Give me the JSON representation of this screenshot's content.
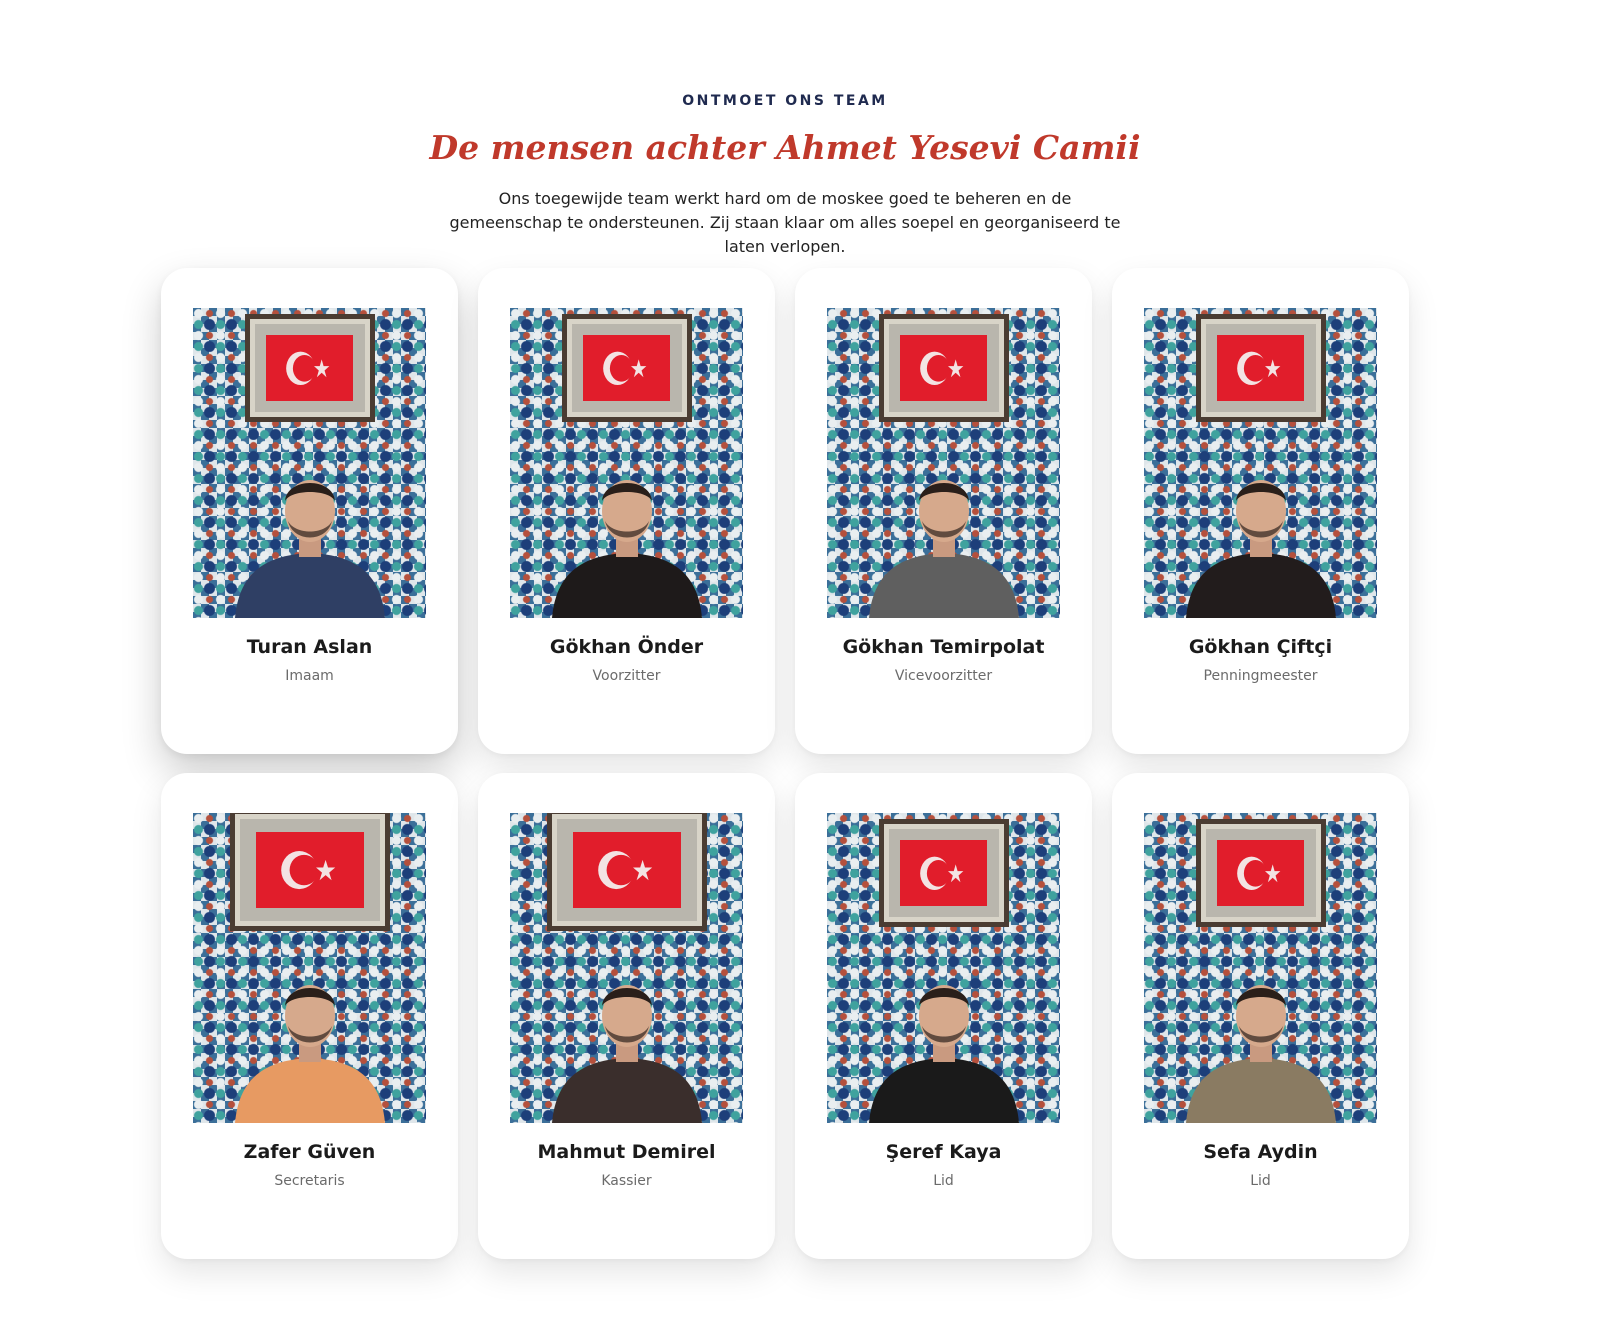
{
  "section": {
    "eyebrow": "ONTMOET ONS TEAM",
    "title": "De mensen achter Ahmet Yesevi Camii",
    "intro": "Ons toegewijde team werkt hard om de moskee goed te beheren en de gemeenschap te ondersteunen. Zij staan klaar om alles soepel en georganiseerd te laten verlopen."
  },
  "colors": {
    "accent": "#c0392b",
    "eyebrow": "#1f2a4f",
    "flag_red": "#e11d2b"
  },
  "team": [
    {
      "name": "Turan Aslan",
      "role": "Imaam",
      "clothing": "#2f3f64"
    },
    {
      "name": "Gökhan Önder",
      "role": "Voorzitter",
      "clothing": "#1e1a1a"
    },
    {
      "name": "Gökhan Temirpolat",
      "role": "Vicevoorzitter",
      "clothing": "#5f5f5f"
    },
    {
      "name": "Gökhan Çiftçi",
      "role": "Penningmeester",
      "clothing": "#221c1c"
    },
    {
      "name": "Zafer Güven",
      "role": "Secretaris",
      "clothing": "#e79a62"
    },
    {
      "name": "Mahmut Demirel",
      "role": "Kassier",
      "clothing": "#3a2e2c"
    },
    {
      "name": "Şeref Kaya",
      "role": "Lid",
      "clothing": "#1a1a1a"
    },
    {
      "name": "Sefa Aydin",
      "role": "Lid",
      "clothing": "#8a7b62"
    }
  ]
}
